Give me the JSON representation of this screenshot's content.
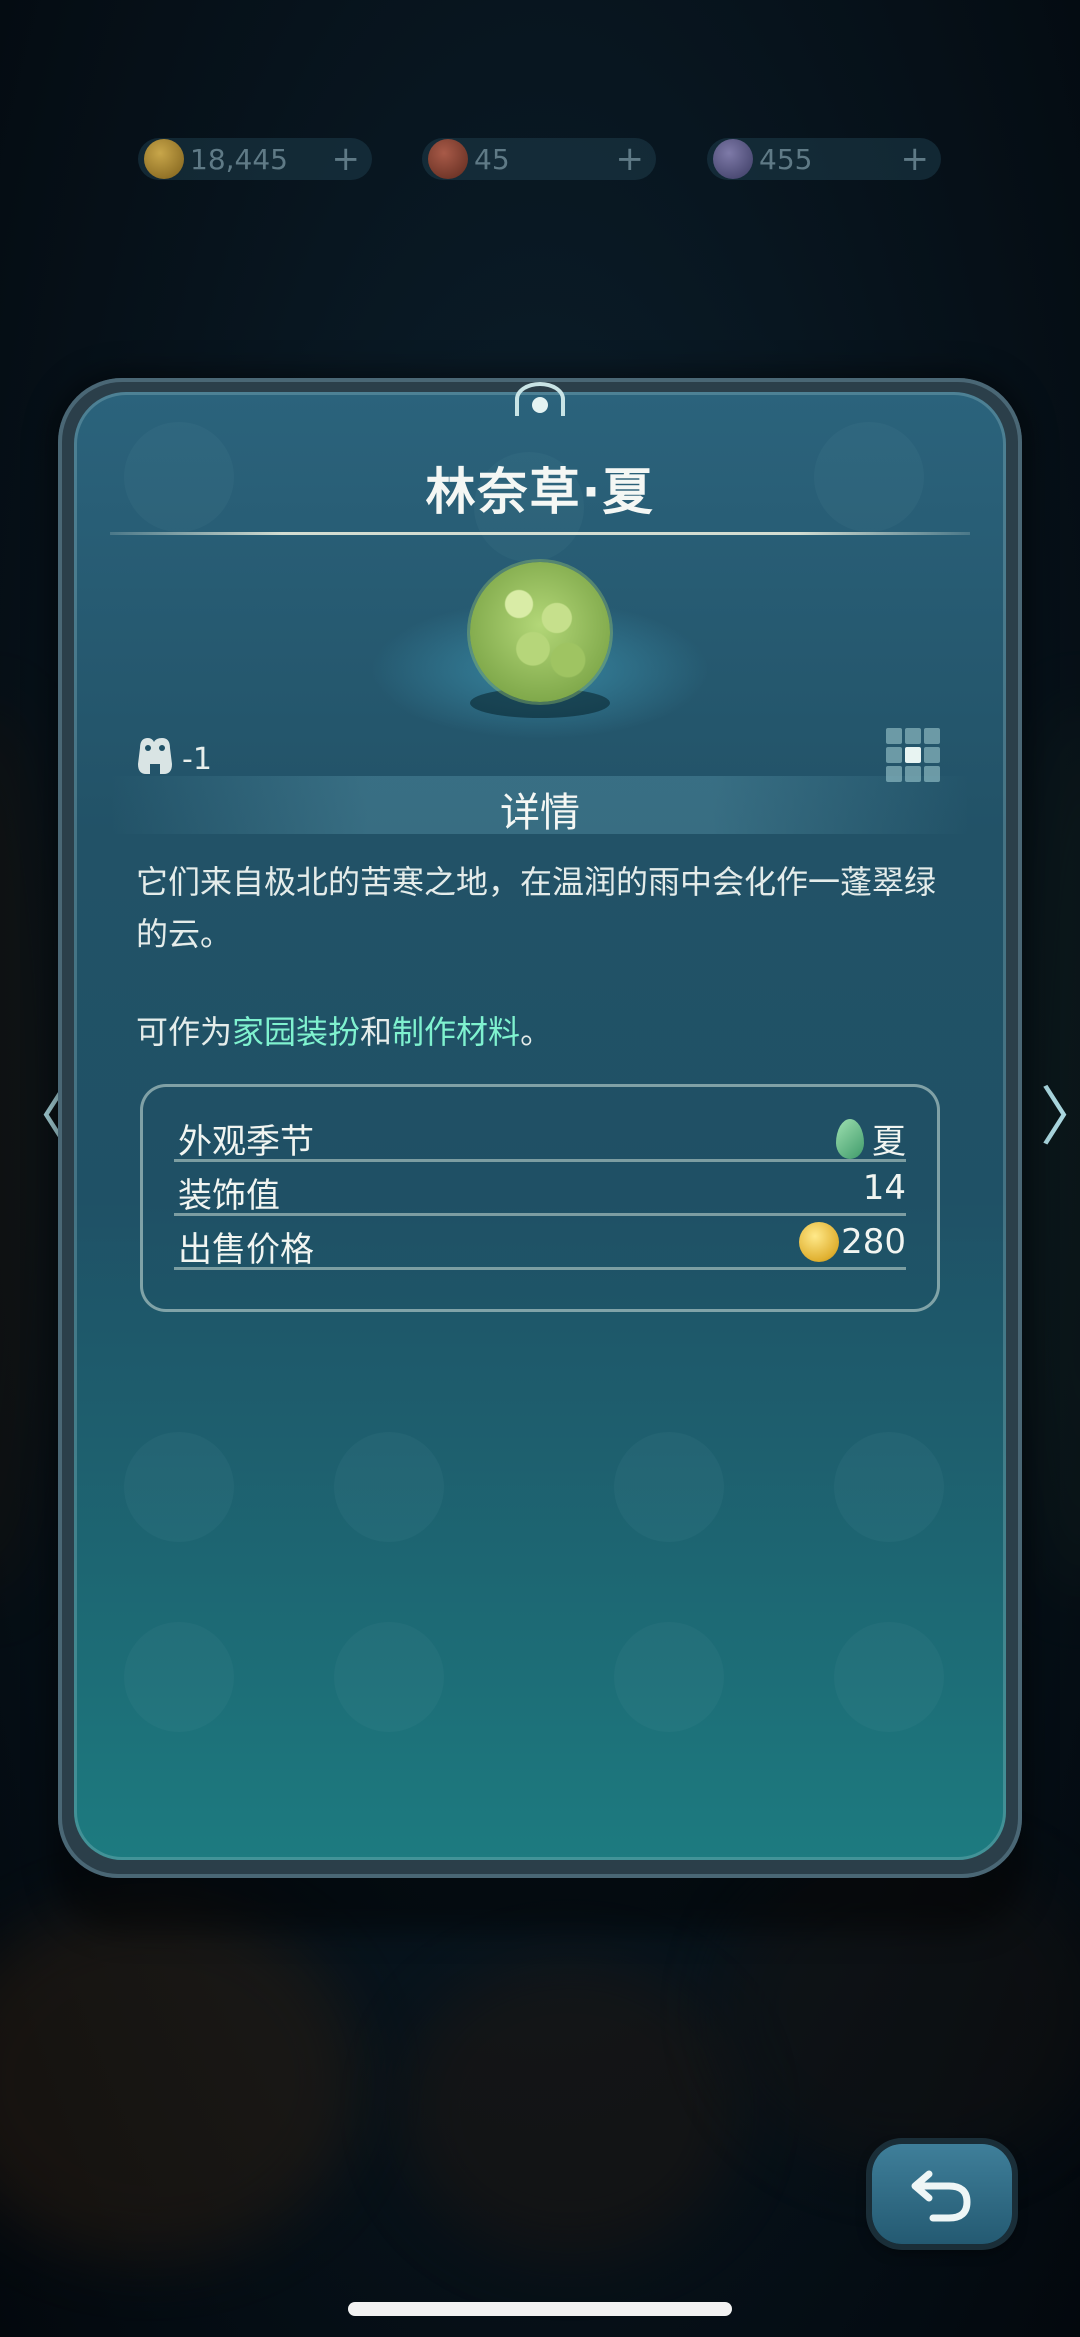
{
  "currencies": [
    {
      "name": "coin",
      "value": "18,445",
      "color": "#c8a64a"
    },
    {
      "name": "seed",
      "value": "45",
      "color": "#a85a48"
    },
    {
      "name": "moon",
      "value": "455",
      "color": "#7e7aa8"
    }
  ],
  "item": {
    "title": "林奈草·夏",
    "capacity_value": "-1",
    "section_title": "详情",
    "description": "它们来自极北的苦寒之地，在温润的雨中会化作一蓬翠绿的云。",
    "uses": {
      "prefix": "可作为",
      "link1": "家园装扮",
      "middle": "和",
      "link2": "制作材料",
      "suffix": "。"
    },
    "info": [
      {
        "label": "外观季节",
        "value": "夏",
        "icon": "leaf-icon"
      },
      {
        "label": "装饰值",
        "value": "14"
      },
      {
        "label": "出售价格",
        "value": "280",
        "icon": "coin-icon"
      }
    ]
  },
  "nav": {
    "left_arrow": "〈",
    "right_arrow": "〉"
  },
  "colors": {
    "highlight": "#7ff2cf",
    "card_top": "#2b637c",
    "card_bottom": "#1d7b80"
  }
}
